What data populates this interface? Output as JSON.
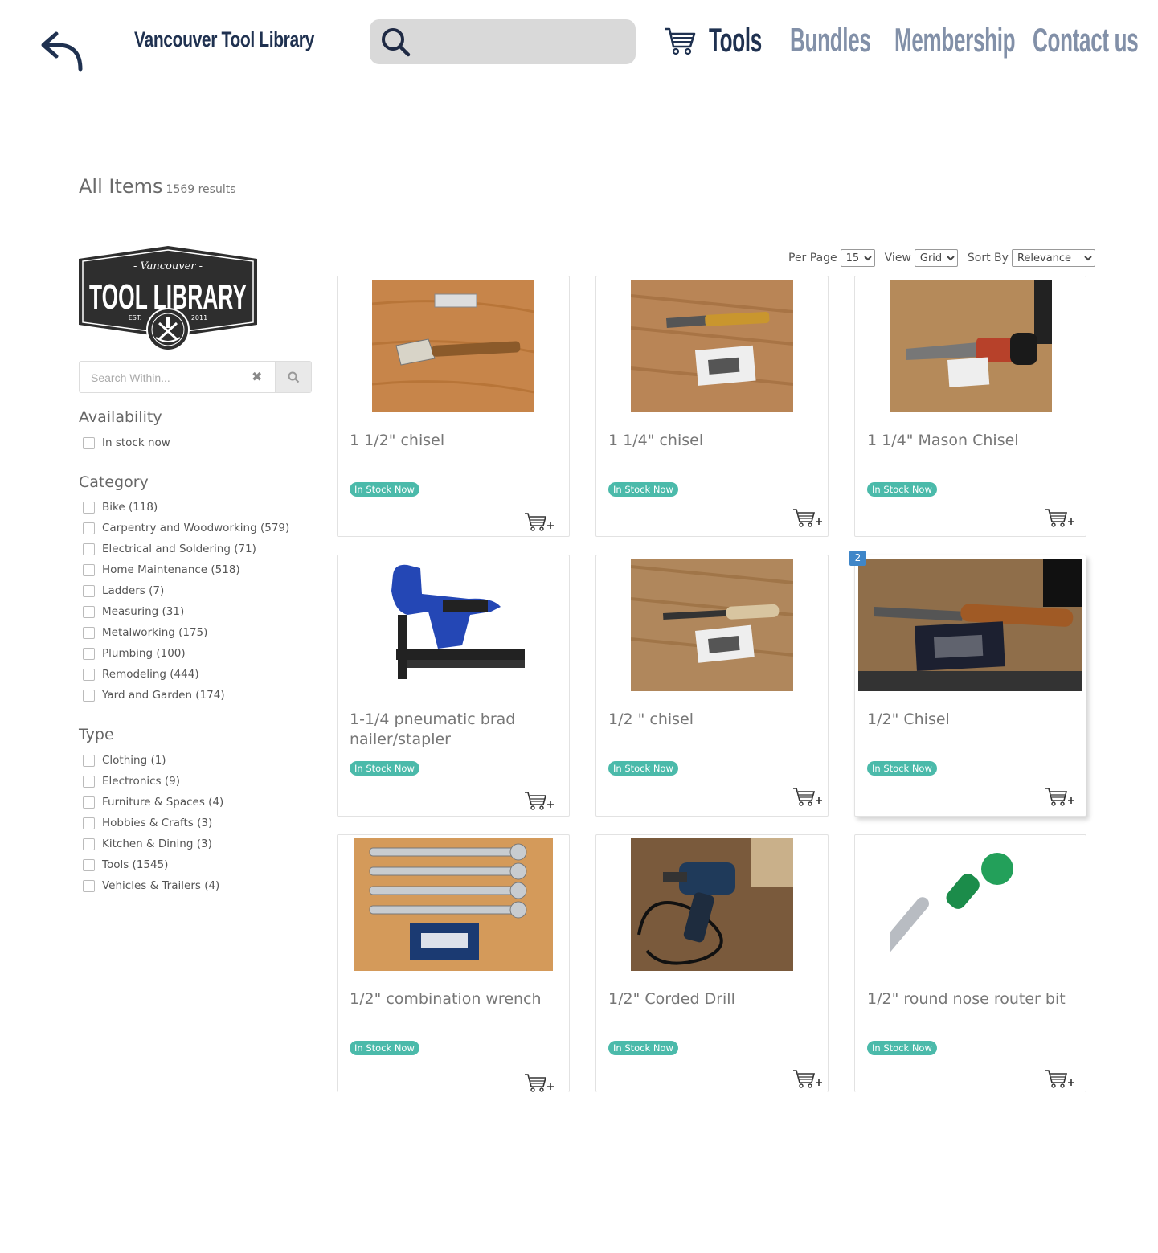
{
  "header": {
    "brand": "Vancouver Tool Library",
    "search_placeholder": "",
    "nav": [
      {
        "label": "Tools",
        "active": true
      },
      {
        "label": "Bundles",
        "active": false
      },
      {
        "label": "Membership",
        "active": false
      },
      {
        "label": "Contact us",
        "active": false
      }
    ]
  },
  "page": {
    "title": "All Items",
    "results": "1569 results"
  },
  "sidebar": {
    "logo_text": {
      "top": "- Vancouver -",
      "main": "TOOL LIBRARY",
      "est": "EST.",
      "year": "2011"
    },
    "search_placeholder": "Search Within...",
    "availability": {
      "title": "Availability",
      "items": [
        "In stock now"
      ]
    },
    "category": {
      "title": "Category",
      "items": [
        "Bike (118)",
        "Carpentry and Woodworking (579)",
        "Electrical and Soldering (71)",
        "Home Maintenance (518)",
        "Ladders (7)",
        "Measuring (31)",
        "Metalworking (175)",
        "Plumbing (100)",
        "Remodeling (444)",
        "Yard and Garden (174)"
      ]
    },
    "type": {
      "title": "Type",
      "items": [
        "Clothing (1)",
        "Electronics (9)",
        "Furniture & Spaces (4)",
        "Hobbies & Crafts (3)",
        "Kitchen & Dining (3)",
        "Tools (1545)",
        "Vehicles & Trailers (4)"
      ]
    }
  },
  "controls": {
    "per_page_label": "Per Page",
    "per_page_value": "15",
    "view_label": "View",
    "view_value": "Grid",
    "sort_label": "Sort By",
    "sort_value": "Relevance"
  },
  "products": [
    {
      "title": "1 1/2\" chisel",
      "status": "In Stock Now",
      "image": "chisel-wide-on-wood"
    },
    {
      "title": "1 1/4\" chisel",
      "status": "In Stock Now",
      "image": "chisel-on-wood"
    },
    {
      "title": "1 1/4\" Mason Chisel",
      "status": "In Stock Now",
      "image": "mason-chisel-on-wood"
    },
    {
      "title": "1-1/4 pneumatic brad nailer/stapler",
      "status": "In Stock Now",
      "image": "blue-brad-nailer"
    },
    {
      "title": "1/2 \" chisel",
      "status": "In Stock Now",
      "image": "chisel-on-wood"
    },
    {
      "title": "1/2\" Chisel",
      "status": "In Stock Now",
      "image": "wooden-handle-chisel",
      "image_count": "2"
    },
    {
      "title": "1/2\" combination wrench",
      "status": "In Stock Now",
      "image": "ratchet-wrenches"
    },
    {
      "title": "1/2\" Corded Drill",
      "status": "In Stock Now",
      "image": "corded-drill"
    },
    {
      "title": "1/2\" round nose router bit",
      "status": "In Stock Now",
      "image": "router-bit"
    }
  ],
  "colors": {
    "brand_navy": "#1f3150",
    "nav_inactive": "#8290a8",
    "badge_teal": "#4bbaaa",
    "count_blue": "#3f86c8"
  }
}
